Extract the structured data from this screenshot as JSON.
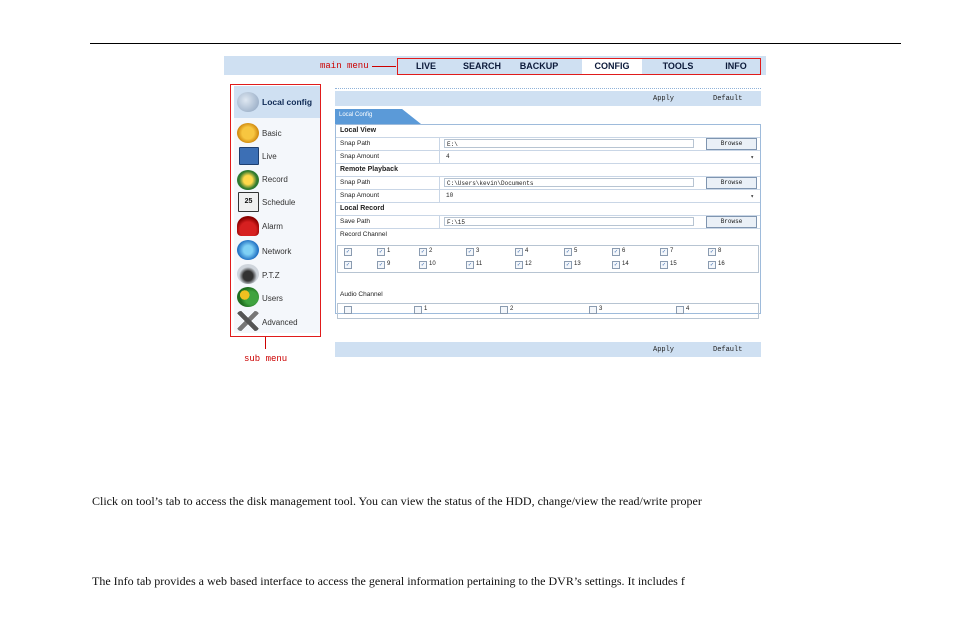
{
  "main_menu": {
    "annotation": "main menu",
    "items": [
      "LIVE",
      "SEARCH",
      "BACKUP",
      "CONFIG",
      "TOOLS",
      "INFO"
    ],
    "active": "CONFIG"
  },
  "sub_menu": {
    "annotation": "sub menu",
    "header": "Local config",
    "items": [
      "Basic",
      "Live",
      "Record",
      "Schedule",
      "Alarm",
      "Network",
      "P.T.Z",
      "Users",
      "Advanced"
    ],
    "schedule_icon_text": "25"
  },
  "toolbar": {
    "apply": "Apply",
    "default": "Default"
  },
  "tab": {
    "label": "Local Config"
  },
  "local_view": {
    "title": "Local View",
    "snap_path_label": "Snap Path",
    "snap_path_value": "E:\\",
    "snap_amount_label": "Snap Amount",
    "snap_amount_value": "4"
  },
  "remote_playback": {
    "title": "Remote Playback",
    "snap_path_label": "Snap Path",
    "snap_path_value": "C:\\Users\\kevin\\Documents",
    "snap_amount_label": "Snap Amount",
    "snap_amount_value": "10"
  },
  "local_record": {
    "title": "Local Record",
    "save_path_label": "Save Path",
    "save_path_value": "F:\\15"
  },
  "browse_label": "Browse",
  "record_channel": {
    "title": "Record Channel",
    "row1": [
      "",
      "1",
      "2",
      "3",
      "4",
      "5",
      "6",
      "7",
      "8"
    ],
    "row2": [
      "",
      "9",
      "10",
      "11",
      "12",
      "13",
      "14",
      "15",
      "16"
    ]
  },
  "audio_channel": {
    "title": "Audio Channel",
    "items": [
      "",
      "1",
      "2",
      "3",
      "4"
    ]
  },
  "paragraphs": [
    "Click on tool’s tab to access the disk management tool. You can view the status of the HDD, change/view the read/write proper",
    "The Info tab provides a web based interface to access the general information pertaining to the DVR’s settings. It includes f"
  ],
  "colors": {
    "menu_bg": "#cfe0f2",
    "annotation": "#cc0000",
    "tab": "#5b9ad8"
  }
}
